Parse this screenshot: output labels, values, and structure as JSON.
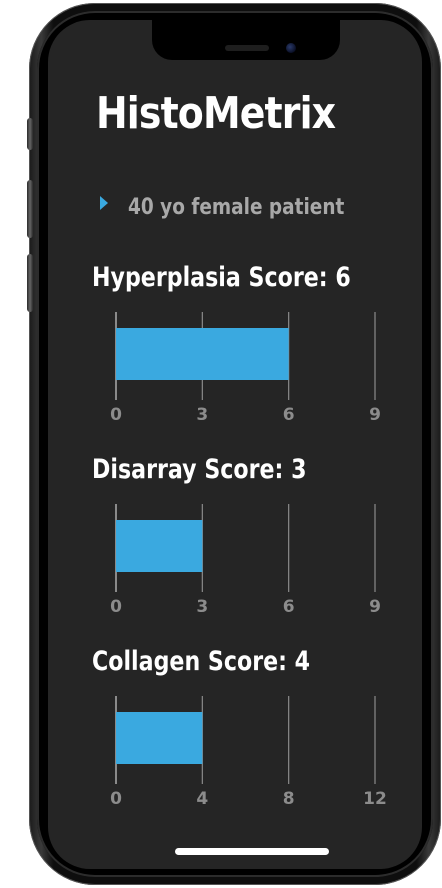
{
  "app": {
    "title": "HistoMetrix"
  },
  "patient": {
    "description": "40 yo female patient",
    "bullet_icon": "triangle-right-icon"
  },
  "colors": {
    "bar": "#3aa9e0",
    "background": "#252525",
    "title_text": "#ffffff",
    "subtitle_text": "#a8a8a8",
    "tick_text": "#8c8c8c",
    "grid": "#8a8a8a"
  },
  "scores": [
    {
      "title": "Hyperplasia Score: 6",
      "value": 6,
      "ticks": [
        "0",
        "3",
        "6",
        "9"
      ],
      "max": 9
    },
    {
      "title": "Disarray Score: 3",
      "value": 3,
      "ticks": [
        "0",
        "3",
        "6",
        "9"
      ],
      "max": 9
    },
    {
      "title": "Collagen Score: 4",
      "value": 4,
      "ticks": [
        "0",
        "4",
        "8",
        "12"
      ],
      "max": 12
    }
  ],
  "chart_data": [
    {
      "type": "bar",
      "orientation": "horizontal",
      "title": "Hyperplasia Score: 6",
      "categories": [
        ""
      ],
      "values": [
        6
      ],
      "xlim": [
        0,
        9
      ],
      "xticks": [
        0,
        3,
        6,
        9
      ],
      "grid": true
    },
    {
      "type": "bar",
      "orientation": "horizontal",
      "title": "Disarray Score: 3",
      "categories": [
        ""
      ],
      "values": [
        3
      ],
      "xlim": [
        0,
        9
      ],
      "xticks": [
        0,
        3,
        6,
        9
      ],
      "grid": true
    },
    {
      "type": "bar",
      "orientation": "horizontal",
      "title": "Collagen Score: 4",
      "categories": [
        ""
      ],
      "values": [
        4
      ],
      "xlim": [
        0,
        12
      ],
      "xticks": [
        0,
        4,
        8,
        12
      ],
      "grid": true
    }
  ]
}
